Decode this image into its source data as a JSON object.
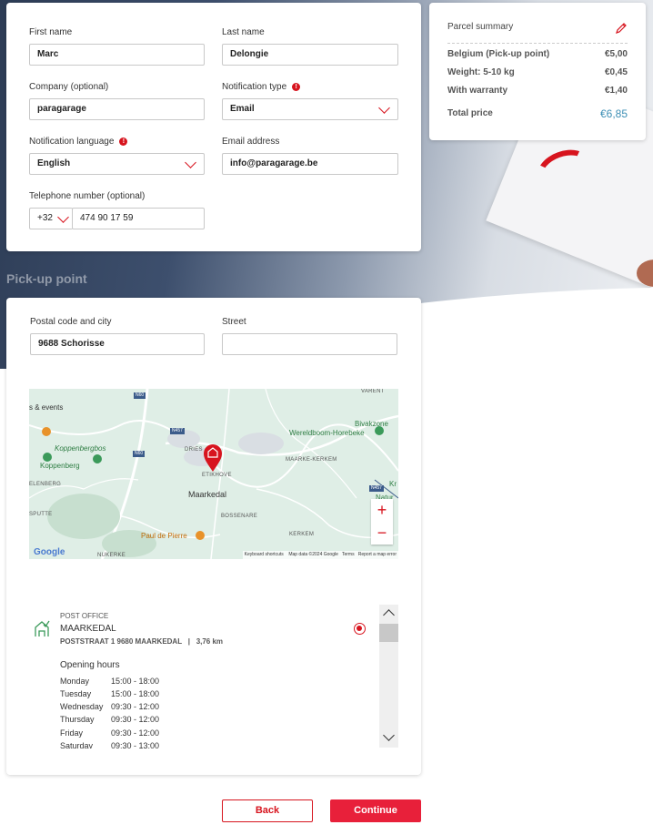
{
  "contact": {
    "first_name": {
      "label": "First name",
      "value": "Marc"
    },
    "last_name": {
      "label": "Last name",
      "value": "Delongie"
    },
    "company": {
      "label": "Company (optional)",
      "value": "paragarage"
    },
    "notification_type": {
      "label": "Notification type",
      "value": "Email"
    },
    "notification_language": {
      "label": "Notification language",
      "value": "English"
    },
    "email": {
      "label": "Email address",
      "value": "info@paragarage.be"
    },
    "telephone": {
      "label": "Telephone number (optional)",
      "prefix": "+32",
      "value": "474 90 17 59"
    }
  },
  "summary": {
    "title": "Parcel summary",
    "rows": [
      {
        "label": "Belgium (Pick-up point)",
        "value": "€5,00"
      },
      {
        "label": "Weight: 5-10 kg",
        "value": "€0,45"
      },
      {
        "label": "With warranty",
        "value": "€1,40"
      }
    ],
    "total_label": "Total price",
    "total_value": "€6,85"
  },
  "pickup": {
    "section_title": "Pick-up point",
    "postal_label": "Postal code and city",
    "postal_value": "9688 Schorisse",
    "street_label": "Street",
    "street_value": ""
  },
  "map": {
    "labels": {
      "fields_events": "s & events",
      "koppenbergbos": "Koppenbergbos",
      "koppenberg": "Koppenberg",
      "elenberg": "ELENBERG",
      "varent": "VARENT",
      "bivakzone": "Bivakzone",
      "wereldboom": "Wereldboom-Horebeke",
      "dries": "DRIES",
      "etikhove": "ETIKHOVE",
      "maarke_kerkem": "MAARKE-KERKEM",
      "maarkedal": "Maarkedal",
      "bossenare": "BOSSENARE",
      "kerkem": "KERKEM",
      "sputte": "SPUTTE",
      "nukerke": "NUKERKE",
      "paul_de_pierre": "Paul de Pierre",
      "natur": "Natur",
      "kr": "Kr"
    },
    "road_labels": [
      "N60",
      "N457",
      "N60",
      "N457"
    ],
    "google": "Google",
    "footer": [
      "Keyboard shortcuts",
      "Map data ©2024 Google",
      "Terms",
      "Report a map error"
    ],
    "zoom_in": "+",
    "zoom_out": "−"
  },
  "location": {
    "type": "POST OFFICE",
    "name": "MAARKEDAL",
    "address": "POSTSTRAAT 1 9680 MAARKEDAL",
    "separator": "|",
    "distance": "3,76 km",
    "hours_title": "Opening hours",
    "hours": [
      {
        "day": "Monday",
        "time": "15:00 - 18:00"
      },
      {
        "day": "Tuesday",
        "time": "15:00 - 18:00"
      },
      {
        "day": "Wednesday",
        "time": "09:30 - 12:00"
      },
      {
        "day": "Thursday",
        "time": "09:30 - 12:00"
      },
      {
        "day": "Friday",
        "time": "09:30 - 12:00"
      },
      {
        "day": "Saturday",
        "time": "09:30 - 13:00"
      }
    ]
  },
  "actions": {
    "back": "Back",
    "continue": "Continue"
  },
  "colors": {
    "accent": "#d7141e",
    "total": "#3d8fb5"
  }
}
